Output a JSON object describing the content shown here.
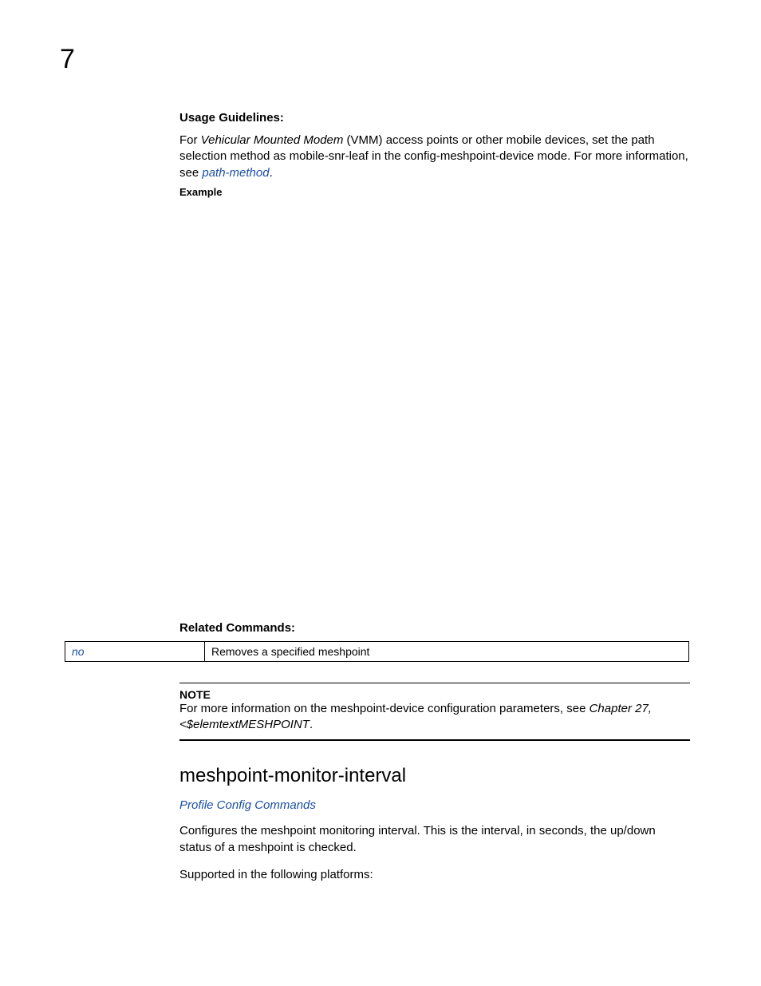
{
  "page_number": "7",
  "usage_guidelines": {
    "heading": "Usage Guidelines:",
    "para_prefix": "For ",
    "para_italic": "Vehicular Mounted Modem",
    "para_mid": " (VMM) access points or other mobile devices, set the path selection method as mobile-snr-leaf in the config-meshpoint-device mode. For more information, see ",
    "para_link": "path-method",
    "para_suffix": ".",
    "example_label": "Example"
  },
  "related_commands": {
    "heading": "Related Commands:",
    "rows": [
      {
        "cmd": "no",
        "desc": "Removes a specified meshpoint"
      }
    ]
  },
  "note": {
    "title": "NOTE",
    "body_prefix": "For more information on the meshpoint-device configuration parameters, see ",
    "body_italic": "Chapter 27, <$elemtextMESHPOINT",
    "body_suffix": "."
  },
  "section": {
    "title": "meshpoint-monitor-interval",
    "breadcrumb": "Profile Config Commands",
    "description": "Configures the meshpoint monitoring interval. This is the interval, in seconds, the up/down status of a meshpoint is checked.",
    "supported": "Supported in the following platforms:"
  }
}
